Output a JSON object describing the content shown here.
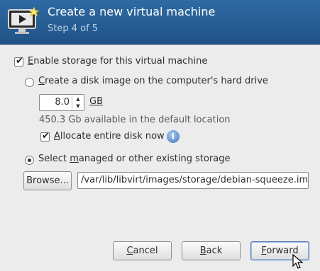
{
  "header": {
    "title": "Create a new virtual machine",
    "step": "Step 4 of 5"
  },
  "storage": {
    "enable_prefix": "E",
    "enable_rest": "nable storage for this virtual machine",
    "enable_checked": true,
    "create_prefix": "C",
    "create_rest": "reate a disk image on the computer's hard drive",
    "create_selected": false,
    "size_value": "8.0",
    "size_unit": "GB",
    "available": "450.3 Gb available in the default location",
    "allocate_prefix": "A",
    "allocate_rest": "llocate entire disk now",
    "allocate_checked": true,
    "existing_before": "Select ",
    "existing_mnemonic": "m",
    "existing_after": "anaged or other existing storage",
    "existing_selected": true,
    "browse_label": "Browse...",
    "path_value": "/var/lib/libvirt/images/storage/debian-squeeze.img"
  },
  "buttons": {
    "cancel_prefix": "C",
    "cancel_rest": "ancel",
    "back_prefix": "B",
    "back_rest": "ack",
    "forward_prefix": "F",
    "forward_rest": "orward"
  },
  "colors": {
    "header_bg": "#2a5f96",
    "header_title": "#ffffff",
    "header_step": "#b9cee4",
    "focus_border": "#4d79b3"
  },
  "icons": [
    "monitor-play-icon",
    "info-icon",
    "mouse-pointer-icon"
  ]
}
